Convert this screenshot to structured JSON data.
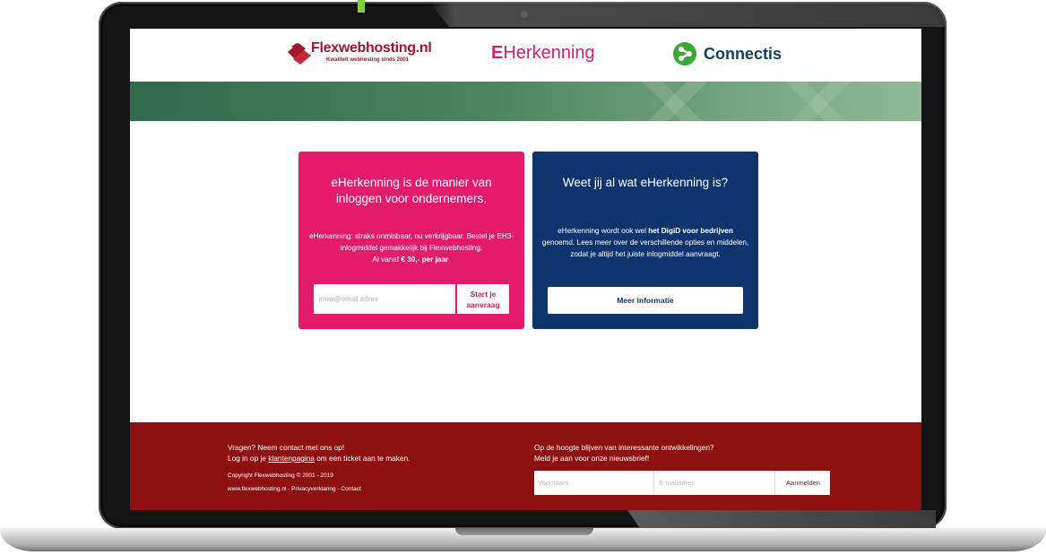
{
  "header": {
    "flexwebhosting": {
      "name": "Flexwebhosting.nl",
      "tagline": "Kwaliteit webhosting sinds 2001"
    },
    "eherkenning": {
      "mark": "E",
      "name": "Herkenning"
    },
    "connectis": {
      "name": "Connectis"
    }
  },
  "cards": {
    "pink": {
      "title": "eHerkenning is de manier van inloggen voor ondernemers.",
      "text_1": "eHerkenning: straks onmisbaar, nu verkrijgbaar. Bestel je EH3-inlogmiddel gemakkelijk bij Flexwebhosting.",
      "text_2": "Al vanaf ",
      "price": "€ 30,- per jaar",
      "text_3": ".",
      "email_placeholder": "jouw@email.adres",
      "start_line1": "Start je",
      "start_line2": "aanvraag"
    },
    "blue": {
      "title": "Weet jij al wat eHerkenning is?",
      "text_1": "eHerkenning wordt ook wel ",
      "text_bold": "het DigiD voor bedrijven",
      "text_2": " genoemd. Lees meer over de verschillende opties en middelen, zodat je altijd het juiste inlogmiddel aanvraagt.",
      "button": "Meer informatie"
    }
  },
  "footer": {
    "contact_line1": "Vragen? Neem contact met ons op!",
    "contact_line2_pre": "Log in op je ",
    "contact_link": "klantenpagina",
    "contact_line2_post": " om een ticket aan te maken.",
    "copyright": "Copyright Flexwebhosting © 2001 - 2019",
    "legal": "www.flexwebhosting.nl - Privacyverklaring - Contact",
    "newsletter_line1": "Op de hoogte blijven van interessante ontwikkelingen?",
    "newsletter_line2": "Meld je aan voor onze nieuwsbrief!",
    "first_name_placeholder": "Voornaam",
    "email_placeholder": "E-mailadres",
    "submit": "Aanmelden"
  },
  "colors": {
    "pink": "#e21c6b",
    "navy": "#0f356e",
    "footer_red": "#8e1111",
    "banner_green": "#4a855e",
    "flex_red": "#a3152a"
  }
}
